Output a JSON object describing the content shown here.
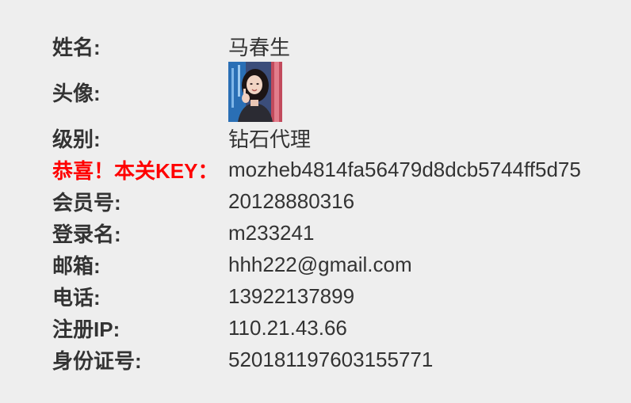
{
  "profile": {
    "rows": [
      {
        "label": "姓名:",
        "value": "马春生"
      },
      {
        "label": "头像:"
      },
      {
        "label": "级别:",
        "value": "钻石代理"
      },
      {
        "label": "恭喜！本关KEY：",
        "value": "mozheb4814fa56479d8dcb5744ff5d75"
      },
      {
        "label": "会员号:",
        "value": "20128880316"
      },
      {
        "label": "登录名:",
        "value": "m233241"
      },
      {
        "label": "邮箱:",
        "value": "hhh222@gmail.com"
      },
      {
        "label": "电话:",
        "value": "13922137899"
      },
      {
        "label": "注册IP:",
        "value": "110.21.43.66"
      },
      {
        "label": "身份证号:",
        "value": "520181197603155771"
      }
    ]
  },
  "colors": {
    "background": "#eeeeee",
    "text": "#333333",
    "key_label": "#ff0000"
  }
}
